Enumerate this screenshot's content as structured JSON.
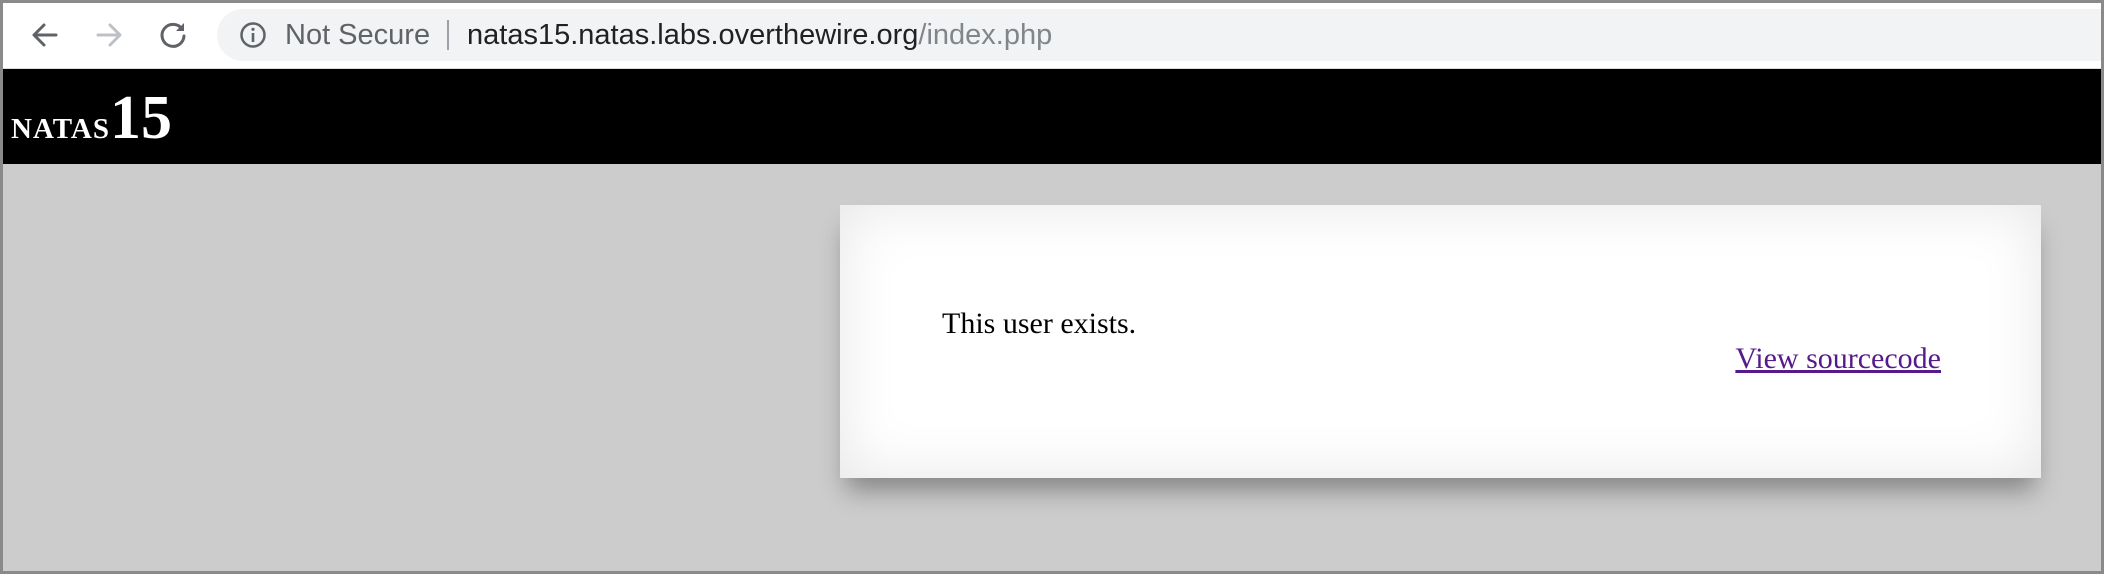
{
  "browser": {
    "security_label": "Not Secure",
    "url_host": "natas15.natas.labs.overthewire.org",
    "url_path": "/index.php",
    "icons": {
      "back": "back-arrow-icon",
      "forward": "forward-arrow-icon",
      "reload": "reload-icon",
      "info": "info-icon"
    }
  },
  "header": {
    "title_word": "NATAS",
    "title_number": "15"
  },
  "content": {
    "message": "This user exists.",
    "source_link_label": "View sourcecode"
  },
  "colors": {
    "page_background": "#cccccc",
    "header_background": "#000000",
    "link_color": "#551a8b"
  }
}
